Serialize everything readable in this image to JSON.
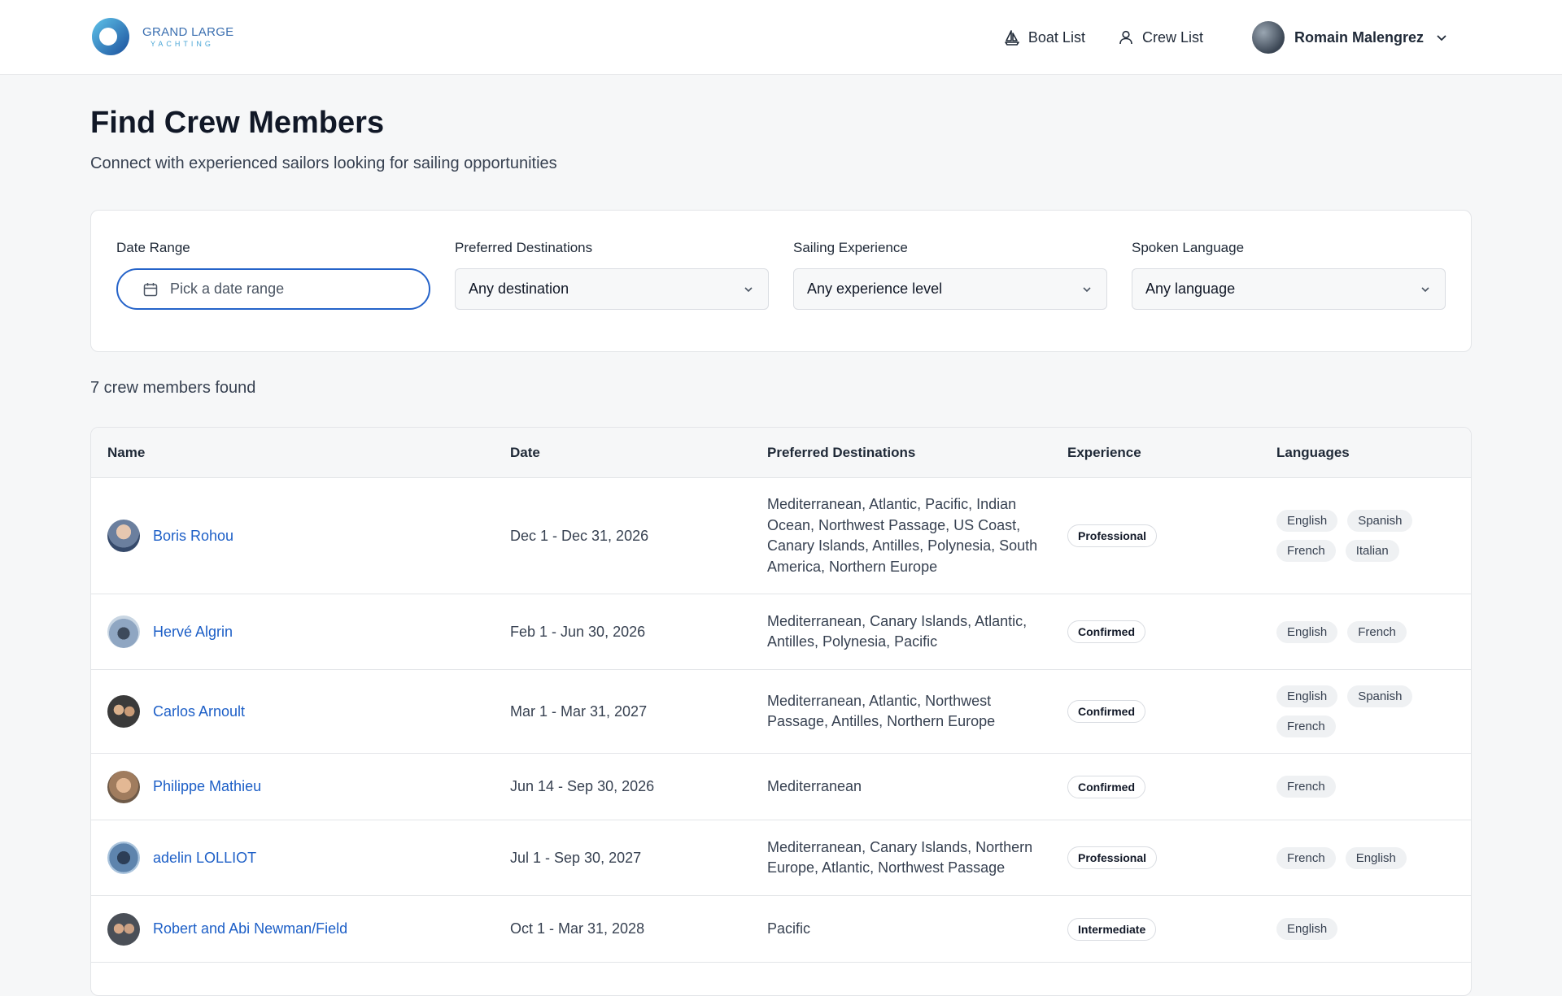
{
  "brand": {
    "line1": "GRAND LARGE",
    "line2": "YACHTING"
  },
  "nav": {
    "boat_list": "Boat List",
    "crew_list": "Crew List",
    "user_name": "Romain Malengrez"
  },
  "page": {
    "title": "Find Crew Members",
    "subtitle": "Connect with experienced sailors looking for sailing opportunities"
  },
  "filters": {
    "date_range": {
      "label": "Date Range",
      "placeholder": "Pick a date range"
    },
    "destinations": {
      "label": "Preferred Destinations",
      "value": "Any destination"
    },
    "experience": {
      "label": "Sailing Experience",
      "value": "Any experience level"
    },
    "language": {
      "label": "Spoken Language",
      "value": "Any language"
    }
  },
  "results_count": "7 crew members found",
  "table": {
    "headers": {
      "name": "Name",
      "date": "Date",
      "destinations": "Preferred Destinations",
      "experience": "Experience",
      "languages": "Languages"
    },
    "rows": [
      {
        "name": "Boris Rohou",
        "date": "Dec 1 - Dec 31, 2026",
        "destinations": "Mediterranean, Atlantic, Pacific, Indian Ocean, Northwest Passage, US Coast, Canary Islands, Antilles, Polynesia, South America, Northern Europe",
        "experience": "Professional",
        "languages": [
          "English",
          "Spanish",
          "French",
          "Italian"
        ]
      },
      {
        "name": "Hervé Algrin",
        "date": "Feb 1 - Jun 30, 2026",
        "destinations": "Mediterranean, Canary Islands, Atlantic, Antilles, Polynesia, Pacific",
        "experience": "Confirmed",
        "languages": [
          "English",
          "French"
        ]
      },
      {
        "name": "Carlos Arnoult",
        "date": "Mar 1 - Mar 31, 2027",
        "destinations": "Mediterranean, Atlantic, Northwest Passage, Antilles, Northern Europe",
        "experience": "Confirmed",
        "languages": [
          "English",
          "Spanish",
          "French"
        ]
      },
      {
        "name": "Philippe Mathieu",
        "date": "Jun 14 - Sep 30, 2026",
        "destinations": "Mediterranean",
        "experience": "Confirmed",
        "languages": [
          "French"
        ]
      },
      {
        "name": "adelin LOLLIOT",
        "date": "Jul 1 - Sep 30, 2027",
        "destinations": "Mediterranean, Canary Islands, Northern Europe, Atlantic, Northwest Passage",
        "experience": "Professional",
        "languages": [
          "French",
          "English"
        ]
      },
      {
        "name": "Robert and Abi Newman/Field",
        "date": "Oct 1 - Mar 31, 2028",
        "destinations": "Pacific",
        "experience": "Intermediate",
        "languages": [
          "English"
        ]
      }
    ]
  }
}
